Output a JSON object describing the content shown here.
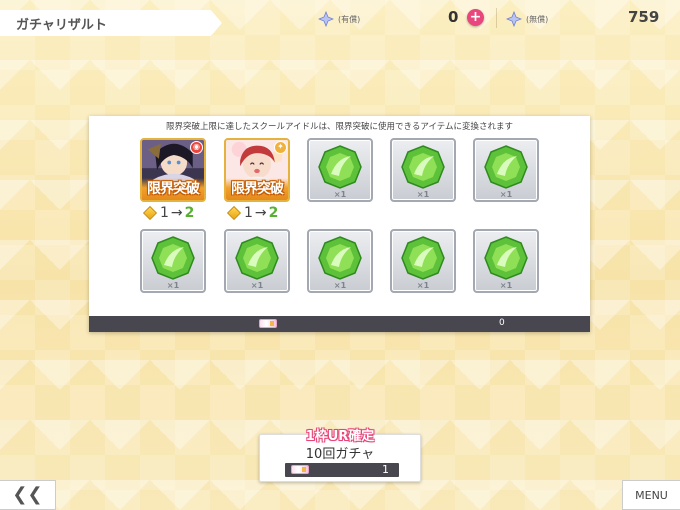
{
  "header": {
    "title": "ガチャリザルト",
    "paid_label": "(有償)",
    "paid_count": "0",
    "plus": "+",
    "free_label": "(無償)",
    "free_count": "759"
  },
  "panel": {
    "note": "限界突破上限に達したスクールアイドルは、限界突破に使用できるアイテムに変換されます",
    "idols": [
      {
        "limit_text": "限界突破",
        "from": "1",
        "arrow": "→",
        "to": "2"
      },
      {
        "limit_text": "限界突破",
        "from": "1",
        "arrow": "→",
        "to": "2"
      }
    ],
    "gem_qty": "×1",
    "footer_count": "0"
  },
  "gacha": {
    "tag": "1枠UR確定",
    "label": "10回ガチャ",
    "cost": "1"
  },
  "nav": {
    "back": "❮❮",
    "menu": "MENU"
  }
}
